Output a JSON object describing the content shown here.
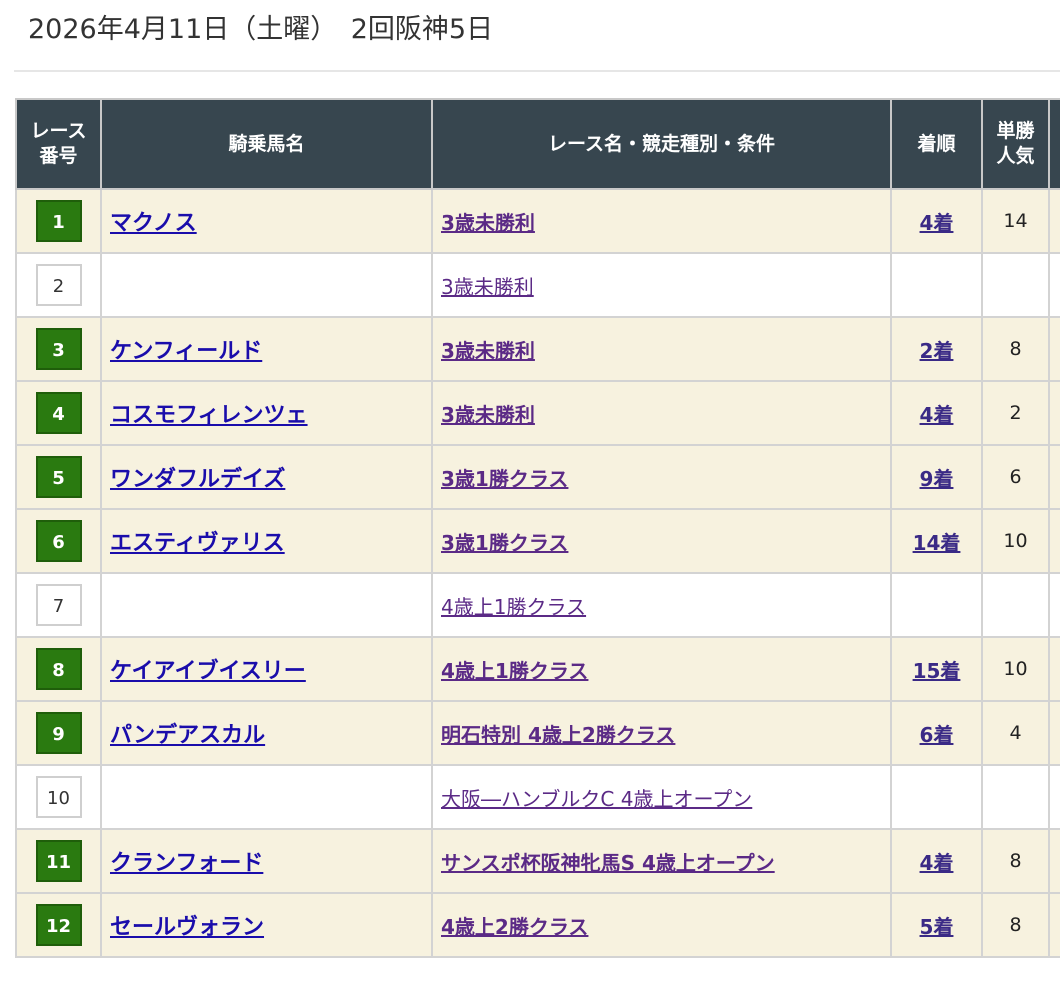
{
  "header": {
    "title": "2026年4月11日（土曜）　2回阪神5日"
  },
  "table": {
    "columns": {
      "race_no": [
        "レース",
        "番号"
      ],
      "horse": "騎乗馬名",
      "race_name": "レース名・競走種別・条件",
      "finish": "着順",
      "popularity": [
        "単勝",
        "人気"
      ]
    },
    "rows": [
      {
        "race_no": "1",
        "active": true,
        "horse": "マクノス",
        "race_name": "3歳未勝利",
        "finish": "4着",
        "popularity": "14"
      },
      {
        "race_no": "2",
        "active": false,
        "horse": "",
        "race_name": "3歳未勝利",
        "finish": "",
        "popularity": ""
      },
      {
        "race_no": "3",
        "active": true,
        "horse": "ケンフィールド",
        "race_name": "3歳未勝利",
        "finish": "2着",
        "popularity": "8"
      },
      {
        "race_no": "4",
        "active": true,
        "horse": "コスモフィレンツェ",
        "race_name": "3歳未勝利",
        "finish": "4着",
        "popularity": "2"
      },
      {
        "race_no": "5",
        "active": true,
        "horse": "ワンダフルデイズ",
        "race_name": "3歳1勝クラス",
        "finish": "9着",
        "popularity": "6"
      },
      {
        "race_no": "6",
        "active": true,
        "horse": "エスティヴァリス",
        "race_name": "3歳1勝クラス",
        "finish": "14着",
        "popularity": "10"
      },
      {
        "race_no": "7",
        "active": false,
        "horse": "",
        "race_name": "4歳上1勝クラス",
        "finish": "",
        "popularity": ""
      },
      {
        "race_no": "8",
        "active": true,
        "horse": "ケイアイブイスリー",
        "race_name": "4歳上1勝クラス",
        "finish": "15着",
        "popularity": "10"
      },
      {
        "race_no": "9",
        "active": true,
        "horse": "パンデアスカル",
        "race_name": "明石特別 4歳上2勝クラス",
        "finish": "6着",
        "popularity": "4"
      },
      {
        "race_no": "10",
        "active": false,
        "horse": "",
        "race_name": "大阪―ハンブルクC 4歳上オープン",
        "finish": "",
        "popularity": ""
      },
      {
        "race_no": "11",
        "active": true,
        "horse": "クランフォード",
        "race_name": "サンスポ杯阪神牝馬S 4歳上オープン",
        "finish": "4着",
        "popularity": "8"
      },
      {
        "race_no": "12",
        "active": true,
        "horse": "セールヴォラン",
        "race_name": "4歳上2勝クラス",
        "finish": "5着",
        "popularity": "8"
      }
    ]
  },
  "colors": {
    "header_bg": "#37464f",
    "badge_active": "#2a7a10",
    "row_active_bg": "#f7f2df",
    "link_horse": "#1a0dab",
    "link_race": "#5b2a86"
  }
}
